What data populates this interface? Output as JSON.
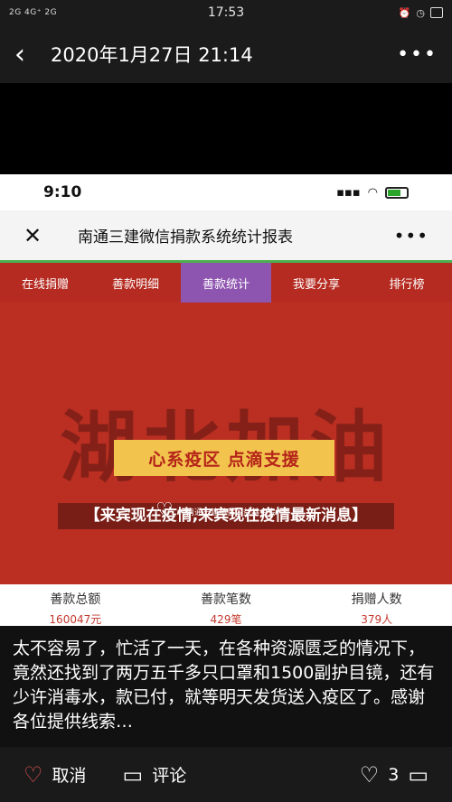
{
  "status_bar": {
    "signal": "2G 4G⁺ 2G",
    "time": "17:53",
    "icons": [
      "alarm-icon",
      "clock-icon",
      "battery-icon"
    ]
  },
  "top_nav": {
    "back_icon": "back-arrow-icon",
    "title": "2020年1月27日 21:14",
    "more_icon": "more-dots-icon"
  },
  "inner_screen": {
    "status_time": "9:10",
    "nav_title": "南通三建微信捐款系统统计报表",
    "tabs": [
      {
        "label": "在线捐赠",
        "active": false
      },
      {
        "label": "善款明细",
        "active": false
      },
      {
        "label": "善款统计",
        "active": true
      },
      {
        "label": "我要分享",
        "active": false
      },
      {
        "label": "排行榜",
        "active": false
      }
    ],
    "banner": {
      "calligraphy": "湖北加油",
      "headline": "【来宾现在疫情,来宾现在疫情最新消息】",
      "slogan": "心系疫区 点滴支援",
      "foundation": "南通三建慈善公益基金会"
    },
    "stats": [
      {
        "label": "善款总额",
        "value": "160047元"
      },
      {
        "label": "善款笔数",
        "value": "429笔"
      },
      {
        "label": "捐赠人数",
        "value": "379人"
      }
    ]
  },
  "caption": "太不容易了，忙活了一天，在各种资源匮乏的情况下，竟然还找到了两万五千多只口罩和1500副护目镜，还有少许消毒水，款已付，就等明天发货送入疫区了。感谢各位提供线索…",
  "bottom_bar": {
    "cancel_label": "取消",
    "comment_label": "评论",
    "like_count": "3"
  },
  "colors": {
    "banner_red": "#ba2f22",
    "tab_active": "#8e55b0",
    "slogan_yellow": "#f2c34d"
  }
}
